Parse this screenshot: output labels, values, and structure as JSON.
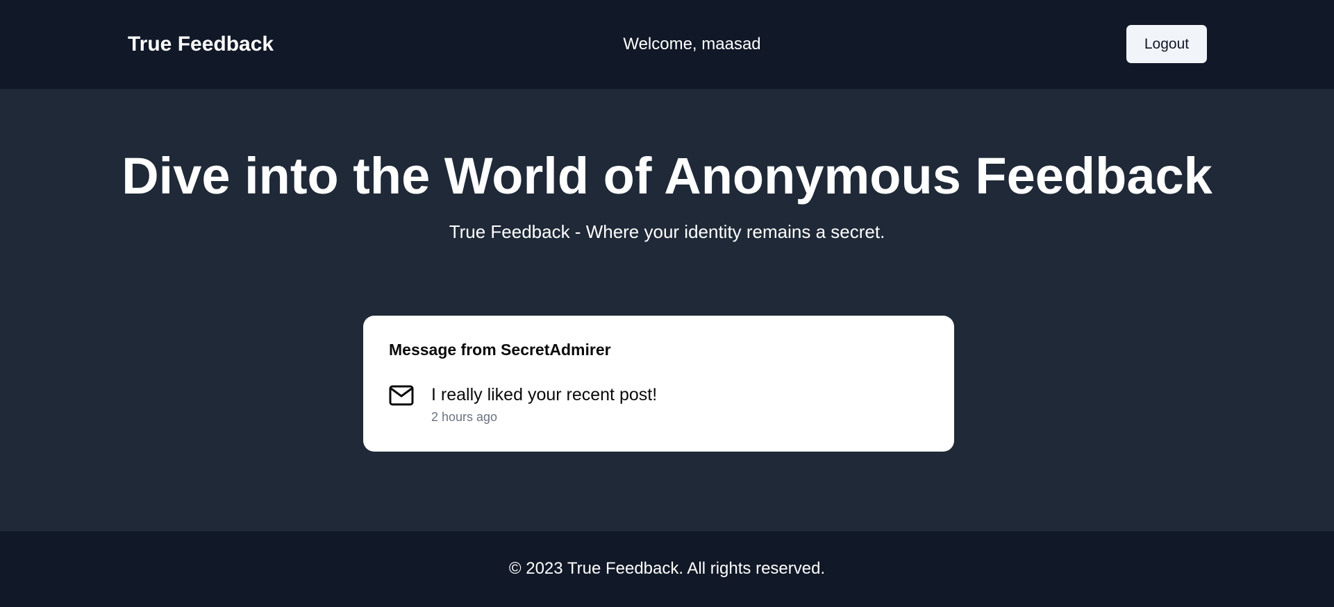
{
  "header": {
    "brand": "True Feedback",
    "welcome": "Welcome, maasad",
    "logout_label": "Logout"
  },
  "hero": {
    "title": "Dive into the World of Anonymous Feedback",
    "subtitle": "True Feedback - Where your identity remains a secret."
  },
  "message_card": {
    "title": "Message from SecretAdmirer",
    "icon": "mail-icon",
    "text": "I really liked your recent post!",
    "time": "2 hours ago"
  },
  "footer": {
    "text": "© 2023 True Feedback. All rights reserved."
  },
  "colors": {
    "nav_background": "#111827",
    "page_background": "#1f2937",
    "card_background": "#ffffff",
    "button_background": "#f1f5f9",
    "muted_text": "#6b7280"
  }
}
